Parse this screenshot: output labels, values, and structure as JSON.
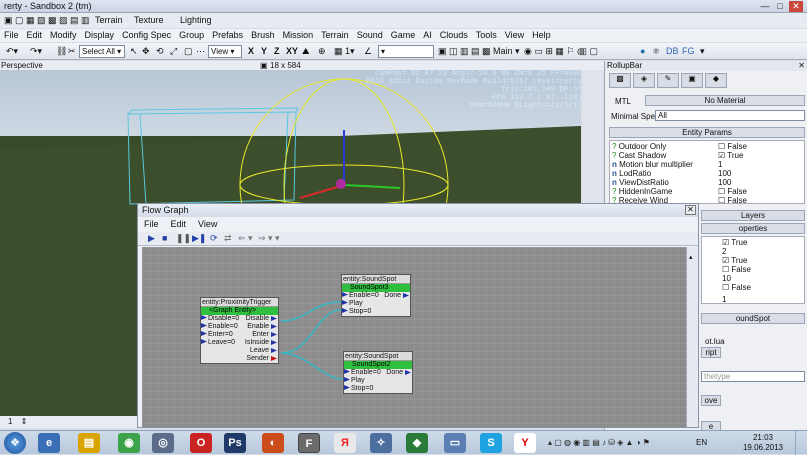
{
  "window": {
    "title": "rerty - Sandbox 2 (tm)"
  },
  "quickbar": {
    "terrain": "Terrain",
    "texture": "Texture",
    "lighting": "Lighting"
  },
  "menu": [
    "File",
    "Edit",
    "Modify",
    "Display",
    "Config Spec",
    "Group",
    "Prefabs",
    "Brush",
    "Mission",
    "Terrain",
    "Sound",
    "Game",
    "AI",
    "Clouds",
    "Tools",
    "View",
    "Help"
  ],
  "toolbar": {
    "select_all": "Select All",
    "coord_view": "View",
    "axes": [
      "X",
      "Y",
      "Z",
      "XY"
    ],
    "layer": "Main",
    "db": "DB",
    "fg": "FG"
  },
  "viewport": {
    "label": "Perspective",
    "resolution": "18 x 584",
    "hud": [
      "CamPos=  81  87  23 Angl=-24  0  80 ZN=0.25 FF=8000",
      "DX10 32bit Custom DevMode Build=5767 Level=rerty",
      "Tris:105,249  DP:55",
      "FPS 112.7 ( 97..119)",
      "Mem=828MB DLights=(1/1/1)"
    ]
  },
  "rollup": {
    "title": "RollupBar",
    "mtl_label": "MTL",
    "mtl_value": "No Material",
    "minspec_label": "Minimal Spec:",
    "minspec_value": "All",
    "entity_params": "Entity Params",
    "params": [
      {
        "icon": "?",
        "name": "Outdoor Only",
        "value": "False",
        "checked": false
      },
      {
        "icon": "?",
        "name": "Cast Shadow",
        "value": "True",
        "checked": true
      },
      {
        "icon": "n",
        "name": "Motion blur multiplier",
        "value": "1",
        "checked": null
      },
      {
        "icon": "n",
        "name": "LodRatio",
        "value": "100",
        "checked": null
      },
      {
        "icon": "n",
        "name": "ViewDistRatio",
        "value": "100",
        "checked": null
      },
      {
        "icon": "?",
        "name": "HiddenInGame",
        "value": "False",
        "checked": false
      },
      {
        "icon": "?",
        "name": "Receive Wind",
        "value": "False",
        "checked": false
      }
    ],
    "layers_btn": "Layers",
    "properties_btn": "operties",
    "props2": [
      {
        "value": "True",
        "checked": true
      },
      {
        "value": "2",
        "checked": null
      },
      {
        "value": "True",
        "checked": true
      },
      {
        "value": "False",
        "checked": false
      },
      {
        "value": "10",
        "checked": null
      },
      {
        "value": "False",
        "checked": false
      },
      {
        "value": "1",
        "checked": null
      }
    ],
    "soundspot": "oundSpot",
    "lua": "ot.lua",
    "script_btn": "ript",
    "type": "thetype",
    "move_btn": "ove",
    "e_btn": "e"
  },
  "flowgraph": {
    "title": "Flow Graph",
    "menu": [
      "File",
      "Edit",
      "View"
    ],
    "nodes": [
      {
        "id": "trigger",
        "header": "entity:ProximityTrigger",
        "entity": "<Graph Entity>",
        "rows": [
          [
            "Disable=0",
            "Disable"
          ],
          [
            "Enable=0",
            "Enable"
          ],
          [
            "Enter=0",
            "Enter"
          ],
          [
            "Leave=0",
            "IsInside"
          ],
          [
            "",
            "Leave"
          ],
          [
            "",
            "Sender"
          ]
        ]
      },
      {
        "id": "spot3",
        "header": "entity:SoundSpot",
        "entity": "SoundSpot3",
        "rows": [
          [
            "Enable=0",
            "Done"
          ],
          [
            "Play",
            ""
          ],
          [
            "Stop=0",
            ""
          ]
        ]
      },
      {
        "id": "spot2",
        "header": "entity:SoundSpot",
        "entity": "SoundSpot2",
        "rows": [
          [
            "Enable=0",
            "Done"
          ],
          [
            "Play",
            ""
          ],
          [
            "Stop=0",
            ""
          ]
        ]
      }
    ]
  },
  "statusbar": {
    "value": "1"
  },
  "taskbar": {
    "time": "21:03",
    "date": "19.06.2013",
    "lang": "EN"
  }
}
